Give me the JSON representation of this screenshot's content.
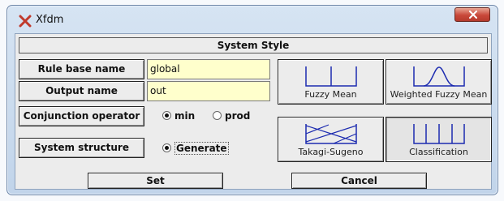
{
  "window": {
    "title": "Xfdm"
  },
  "header": {
    "title": "System Style"
  },
  "form": {
    "rule_base_name_label": "Rule base name",
    "rule_base_name_value": "global",
    "output_name_label": "Output name",
    "output_name_value": "out",
    "conjunction_label": "Conjunction operator",
    "conjunction_options": [
      {
        "label": "min",
        "selected": true
      },
      {
        "label": "prod",
        "selected": false
      }
    ],
    "system_structure_label": "System structure",
    "system_structure_option": {
      "label": "Generate",
      "selected": true
    }
  },
  "styles": [
    {
      "label": "Fuzzy Mean",
      "icon": "fuzzy-mean-icon"
    },
    {
      "label": "Weighted Fuzzy Mean",
      "icon": "weighted-fuzzy-mean-icon"
    },
    {
      "label": "Takagi-Sugeno",
      "icon": "takagi-sugeno-icon"
    },
    {
      "label": "Classification",
      "icon": "classification-icon",
      "selected": true
    }
  ],
  "buttons": {
    "set": "Set",
    "cancel": "Cancel"
  },
  "colors": {
    "field_bg": "#ffffcc",
    "close_red": "#c9483a",
    "frame_blue": "#c1d4ea"
  }
}
